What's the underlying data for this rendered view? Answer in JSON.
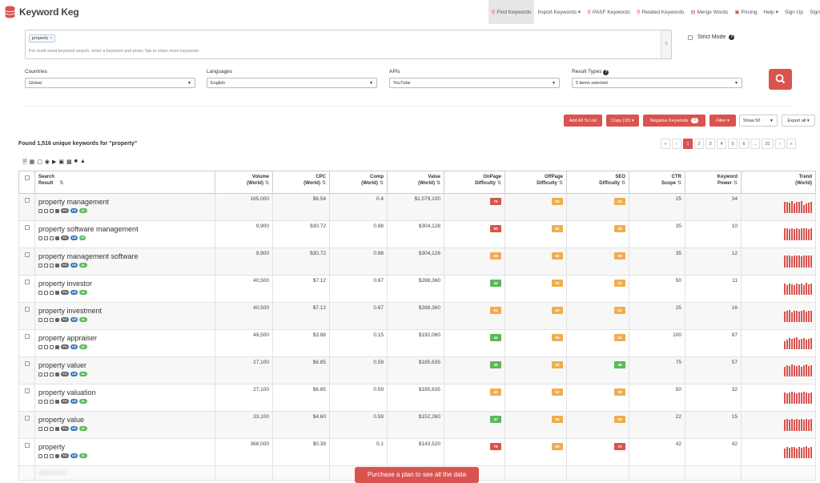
{
  "app": {
    "title": "Keyword Keg"
  },
  "nav": [
    {
      "icon": "search-icon",
      "label": "Find Keywords",
      "active": true
    },
    {
      "icon": "",
      "label": "Import Keywords ▾"
    },
    {
      "icon": "search-icon",
      "label": "PASF Keywords"
    },
    {
      "icon": "search-icon",
      "label": "Related Keywords"
    },
    {
      "icon": "merge-icon",
      "label": "Merge Words"
    },
    {
      "icon": "pricing-icon",
      "label": "Pricing"
    },
    {
      "icon": "",
      "label": "Help ▾"
    },
    {
      "icon": "",
      "label": "Sign Up"
    },
    {
      "icon": "",
      "label": "Sign"
    }
  ],
  "search": {
    "seed_tag": "property",
    "hint": "For multi-seed keyword search, enter a keyword and press Tab to enter more keywords",
    "help": "?",
    "strict_mode": "Strict Mode"
  },
  "filters": {
    "countries": {
      "label": "Countries",
      "value": "Global"
    },
    "languages": {
      "label": "Languages",
      "value": "English"
    },
    "apis": {
      "label": "APIs",
      "value": "YouTube"
    },
    "result_types": {
      "label": "Result Types",
      "value": "5 items selected"
    }
  },
  "actions": {
    "add_all": "Add All To List",
    "copy": "Copy (10) ▾",
    "negative": "Negative Keywords",
    "negative_count": "0",
    "filter": "Filter ▾",
    "show": "Show 50",
    "export": "Export all ▾"
  },
  "results": {
    "found": "Found 1,516 unique keywords for \"property\"",
    "pages": [
      "«",
      "‹",
      "1",
      "2",
      "3",
      "4",
      "5",
      "6",
      "...",
      "31",
      "›",
      "»"
    ]
  },
  "columns": {
    "search_result": [
      "Search",
      "Result"
    ],
    "volume": [
      "Volume",
      "(World)"
    ],
    "cpc": [
      "CPC",
      "(World)"
    ],
    "comp": [
      "Comp",
      "(World)"
    ],
    "value": [
      "Value",
      "(World)"
    ],
    "onpage": [
      "OnPage",
      "Difficulty"
    ],
    "offpage": [
      "OffPage",
      "Difficulty"
    ],
    "seo": [
      "SEO",
      "Difficulty"
    ],
    "ctr": [
      "CTR",
      "Scope"
    ],
    "kwpower": [
      "Keyword",
      "Power"
    ],
    "trend": [
      "Trend",
      "(World)"
    ]
  },
  "colors": {
    "accent": "#d9534f",
    "orange": "#f0ad4e",
    "green": "#5cb85c",
    "blue": "#3a7ab8"
  },
  "rows": [
    {
      "keyword": "property management",
      "volume": "165,000",
      "cpc": "$6.54",
      "comp": "0.4",
      "value": "$1,079,100",
      "onpage": "76",
      "offpage": "58",
      "seo": "63",
      "ctr": "25",
      "power": "34",
      "lang": "AL",
      "trend": [
        80,
        85,
        75,
        90,
        70,
        85,
        80,
        90,
        60,
        70,
        75,
        85
      ]
    },
    {
      "keyword": "property software management",
      "volume": "9,900",
      "cpc": "$30.72",
      "comp": "0.88",
      "value": "$304,128",
      "onpage": "83",
      "offpage": "60",
      "seo": "58",
      "ctr": "35",
      "power": "10",
      "lang": "PI",
      "trend": [
        90,
        90,
        85,
        90,
        80,
        90,
        85,
        90,
        90,
        90,
        85,
        90
      ]
    },
    {
      "keyword": "property management software",
      "volume": "9,900",
      "cpc": "$30.72",
      "comp": "0.88",
      "value": "$304,128",
      "onpage": "68",
      "offpage": "60",
      "seo": "55",
      "ctr": "35",
      "power": "12",
      "lang": "AL",
      "trend": [
        90,
        90,
        90,
        85,
        90,
        90,
        90,
        85,
        90,
        90,
        90,
        90
      ]
    },
    {
      "keyword": "property investor",
      "volume": "40,500",
      "cpc": "$7.12",
      "comp": "0.67",
      "value": "$288,360",
      "onpage": "34",
      "offpage": "55",
      "seo": "51",
      "ctr": "50",
      "power": "11",
      "lang": "AL",
      "trend": [
        80,
        70,
        85,
        75,
        70,
        80,
        75,
        85,
        70,
        90,
        75,
        80
      ]
    },
    {
      "keyword": "property investment",
      "volume": "40,500",
      "cpc": "$7.12",
      "comp": "0.67",
      "value": "$288,360",
      "onpage": "54",
      "offpage": "60",
      "seo": "62",
      "ctr": "25",
      "power": "16",
      "lang": "AL",
      "trend": [
        75,
        80,
        90,
        70,
        85,
        80,
        75,
        85,
        90,
        75,
        80,
        85
      ]
    },
    {
      "keyword": "property appraiser",
      "volume": "49,500",
      "cpc": "$3.88",
      "comp": "0.15",
      "value": "$192,060",
      "onpage": "44",
      "offpage": "55",
      "seo": "52",
      "ctr": "100",
      "power": "87",
      "lang": "AL",
      "trend": [
        60,
        70,
        80,
        75,
        85,
        90,
        70,
        75,
        80,
        70,
        75,
        80
      ]
    },
    {
      "keyword": "property valuer",
      "volume": "27,100",
      "cpc": "$6.85",
      "comp": "0.59",
      "value": "$185,635",
      "onpage": "35",
      "offpage": "53",
      "seo": "49",
      "ctr": "75",
      "power": "57",
      "lang": "AL",
      "trend": [
        70,
        85,
        75,
        90,
        80,
        75,
        85,
        70,
        80,
        90,
        75,
        85
      ]
    },
    {
      "keyword": "property valuation",
      "volume": "27,100",
      "cpc": "$6.85",
      "comp": "0.59",
      "value": "$185,635",
      "onpage": "50",
      "offpage": "62",
      "seo": "58",
      "ctr": "50",
      "power": "32",
      "lang": "AL",
      "trend": [
        80,
        75,
        85,
        90,
        80,
        75,
        85,
        80,
        90,
        85,
        75,
        80
      ]
    },
    {
      "keyword": "property value",
      "volume": "33,100",
      "cpc": "$4.60",
      "comp": "0.59",
      "value": "$152,260",
      "onpage": "47",
      "offpage": "66",
      "seo": "60",
      "ctr": "22",
      "power": "15",
      "lang": "AL",
      "trend": [
        85,
        90,
        85,
        90,
        85,
        90,
        85,
        90,
        85,
        90,
        85,
        90
      ]
    },
    {
      "keyword": "property",
      "volume": "368,000",
      "cpc": "$0.39",
      "comp": "0.1",
      "value": "$143,520",
      "onpage": "79",
      "offpage": "69",
      "seo": "73",
      "ctr": "42",
      "power": "42",
      "lang": "AL",
      "trend": [
        70,
        80,
        75,
        85,
        80,
        70,
        85,
        75,
        80,
        90,
        75,
        80
      ]
    }
  ],
  "blurred_row": {
    "keyword": "sales fha bc"
  },
  "purchase": "Purchase a plan to see all the data"
}
